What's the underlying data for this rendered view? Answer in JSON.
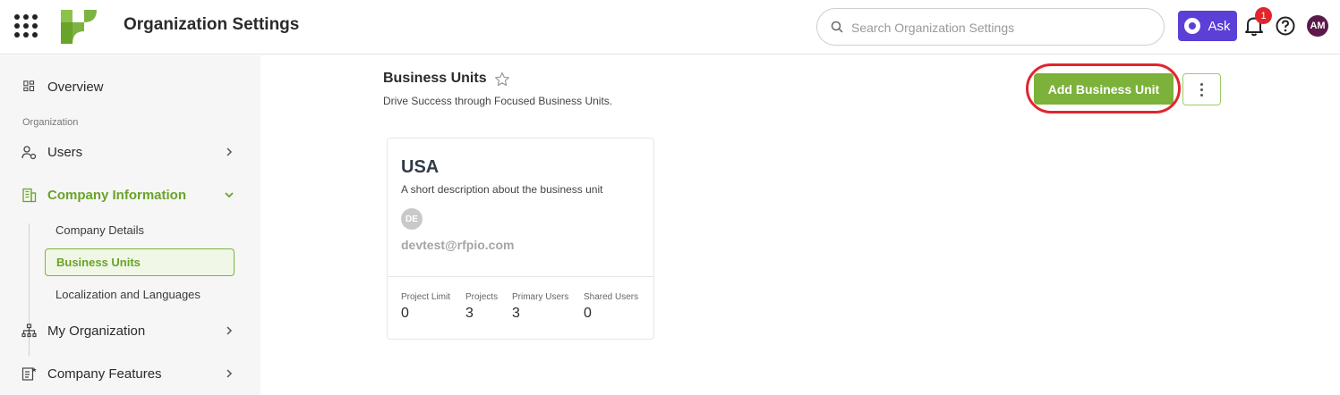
{
  "header": {
    "title": "Organization Settings",
    "search_placeholder": "Search Organization Settings",
    "ask_label": "Ask",
    "notification_count": "1",
    "user_initials": "AM"
  },
  "sidebar": {
    "overview": "Overview",
    "section_label": "Organization",
    "users": "Users",
    "company_information": "Company Information",
    "sub_items": [
      "Company Details",
      "Business Units",
      "Localization and Languages"
    ],
    "my_organization": "My Organization",
    "company_features": "Company Features"
  },
  "main": {
    "title": "Business Units",
    "subtitle": "Drive Success through Focused Business Units.",
    "add_button": "Add Business Unit"
  },
  "card": {
    "title": "USA",
    "description": "A short description about the business unit",
    "avatar_initials": "DE",
    "email": "devtest@rfpio.com",
    "stats": [
      {
        "label": "Project Limit",
        "value": "0"
      },
      {
        "label": "Projects",
        "value": "3"
      },
      {
        "label": "Primary Users",
        "value": "3"
      },
      {
        "label": "Shared Users",
        "value": "0"
      }
    ]
  },
  "colors": {
    "accent_green": "#7cb13a",
    "ask_purple": "#5b3fd6",
    "highlight_red": "#e0262b"
  }
}
